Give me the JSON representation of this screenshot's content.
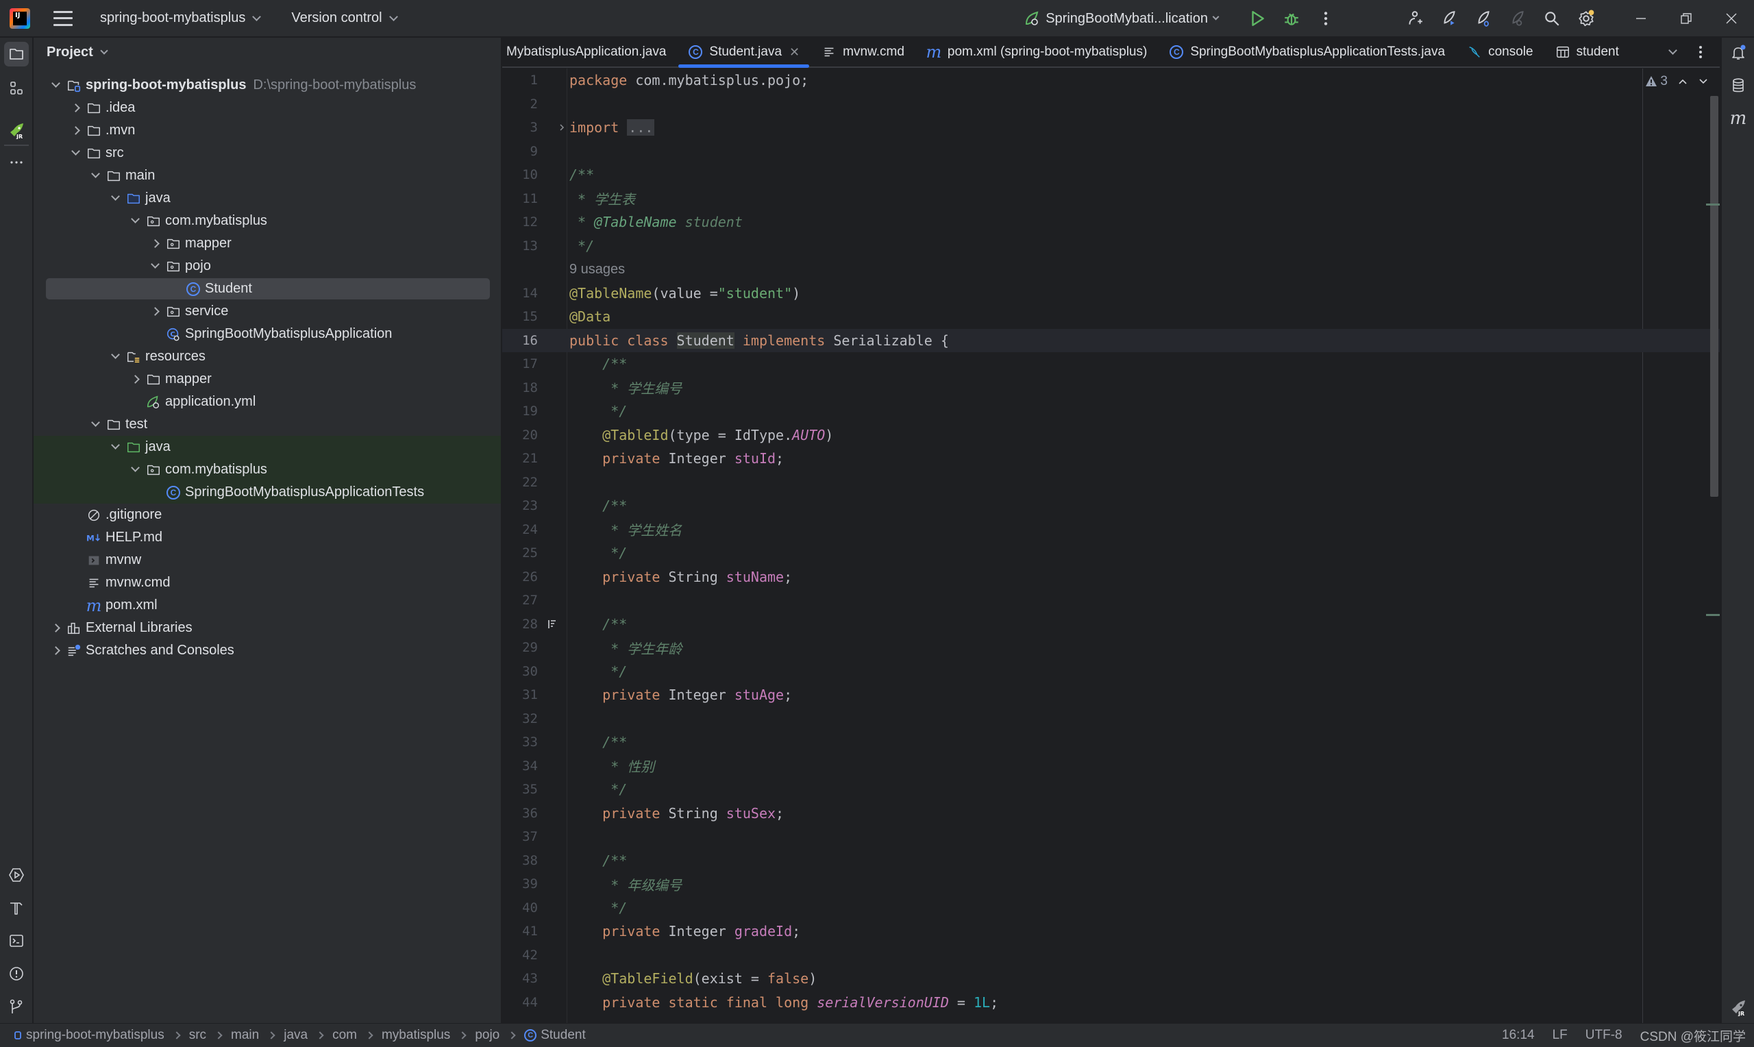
{
  "titlebar": {
    "project_name": "spring-boot-mybatisplus",
    "vcs_label": "Version control",
    "run_config": "SpringBootMybati...lication"
  },
  "project_panel": {
    "title": "Project",
    "tree": [
      {
        "label": "spring-boot-mybatisplus",
        "path": "D:\\spring-boot-mybatisplus",
        "depth": 0,
        "toggle": "expanded",
        "icon": "module-folder-icon",
        "bold": true
      },
      {
        "label": ".idea",
        "depth": 1,
        "toggle": "collapsed",
        "icon": "folder-icon"
      },
      {
        "label": ".mvn",
        "depth": 1,
        "toggle": "collapsed",
        "icon": "folder-icon"
      },
      {
        "label": "src",
        "depth": 1,
        "toggle": "expanded",
        "icon": "folder-icon"
      },
      {
        "label": "main",
        "depth": 2,
        "toggle": "expanded",
        "icon": "folder-icon"
      },
      {
        "label": "java",
        "depth": 3,
        "toggle": "expanded",
        "icon": "source-folder-icon"
      },
      {
        "label": "com.mybatisplus",
        "depth": 4,
        "toggle": "expanded",
        "icon": "package-icon"
      },
      {
        "label": "mapper",
        "depth": 5,
        "toggle": "collapsed",
        "icon": "package-icon"
      },
      {
        "label": "pojo",
        "depth": 5,
        "toggle": "expanded",
        "icon": "package-icon"
      },
      {
        "label": "Student",
        "depth": 6,
        "toggle": "none",
        "icon": "class-icon",
        "selected": true
      },
      {
        "label": "service",
        "depth": 5,
        "toggle": "collapsed",
        "icon": "package-icon"
      },
      {
        "label": "SpringBootMybatisplusApplication",
        "depth": 5,
        "toggle": "none",
        "icon": "spring-class-icon"
      },
      {
        "label": "resources",
        "depth": 3,
        "toggle": "expanded",
        "icon": "resources-folder-icon"
      },
      {
        "label": "mapper",
        "depth": 4,
        "toggle": "collapsed",
        "icon": "folder-icon"
      },
      {
        "label": "application.yml",
        "depth": 4,
        "toggle": "none",
        "icon": "spring-config-icon"
      },
      {
        "label": "test",
        "depth": 2,
        "toggle": "expanded",
        "icon": "folder-icon"
      },
      {
        "label": "java",
        "depth": 3,
        "toggle": "expanded",
        "icon": "test-folder-icon",
        "test": true
      },
      {
        "label": "com.mybatisplus",
        "depth": 4,
        "toggle": "expanded",
        "icon": "package-icon",
        "test": true
      },
      {
        "label": "SpringBootMybatisplusApplicationTests",
        "depth": 5,
        "toggle": "none",
        "icon": "class-icon",
        "test": true
      },
      {
        "label": ".gitignore",
        "depth": 1,
        "toggle": "none",
        "icon": "ignore-file-icon"
      },
      {
        "label": "HELP.md",
        "depth": 1,
        "toggle": "none",
        "icon": "markdown-icon"
      },
      {
        "label": "mvnw",
        "depth": 1,
        "toggle": "none",
        "icon": "shell-script-icon"
      },
      {
        "label": "mvnw.cmd",
        "depth": 1,
        "toggle": "none",
        "icon": "text-file-icon"
      },
      {
        "label": "pom.xml",
        "depth": 1,
        "toggle": "none",
        "icon": "maven-icon"
      },
      {
        "label": "External Libraries",
        "depth": 0,
        "toggle": "collapsed",
        "icon": "libraries-icon"
      },
      {
        "label": "Scratches and Consoles",
        "depth": 0,
        "toggle": "collapsed",
        "icon": "scratches-icon"
      }
    ]
  },
  "tabs": [
    {
      "label": "MybatisplusApplication.java",
      "icon": "none",
      "active": false
    },
    {
      "label": "Student.java",
      "icon": "class-icon",
      "active": true,
      "closable": true
    },
    {
      "label": "mvnw.cmd",
      "icon": "text-file-icon",
      "active": false
    },
    {
      "label": "pom.xml (spring-boot-mybatisplus)",
      "icon": "maven-icon",
      "active": false
    },
    {
      "label": "SpringBootMybatisplusApplicationTests.java",
      "icon": "class-icon",
      "active": false
    },
    {
      "label": "console",
      "icon": "mysql-console-icon",
      "active": false
    },
    {
      "label": "student",
      "icon": "table-icon",
      "active": false
    }
  ],
  "editor": {
    "warnings_count": "3",
    "usages_hint": "9 usages",
    "current_line": 16,
    "lines": [
      {
        "n": "1",
        "tokens": [
          [
            "kw",
            "package"
          ],
          [
            "p",
            " com.mybatisplus.pojo;"
          ]
        ]
      },
      {
        "n": "2",
        "tokens": []
      },
      {
        "n": "3",
        "fold": true,
        "tokens": [
          [
            "kw",
            "import"
          ],
          [
            "p",
            " "
          ],
          [
            "fold",
            "..."
          ]
        ]
      },
      {
        "n": "9",
        "tokens": []
      },
      {
        "n": "10",
        "tokens": [
          [
            "cmt",
            "/**"
          ]
        ]
      },
      {
        "n": "11",
        "tokens": [
          [
            "cmt",
            " * 学生表"
          ]
        ]
      },
      {
        "n": "12",
        "tokens": [
          [
            "cmt",
            " * "
          ],
          [
            "tag",
            "@TableName"
          ],
          [
            "cmt",
            " student"
          ]
        ]
      },
      {
        "n": "13",
        "tokens": [
          [
            "cmt",
            " */"
          ]
        ]
      },
      {
        "n": "",
        "usages": true,
        "tokens": []
      },
      {
        "n": "14",
        "tokens": [
          [
            "ann",
            "@TableName"
          ],
          [
            "p",
            "(value ="
          ],
          [
            "str",
            "\"student\""
          ],
          [
            "p",
            ")"
          ]
        ]
      },
      {
        "n": "15",
        "tokens": [
          [
            "ann",
            "@Data"
          ]
        ]
      },
      {
        "n": "16",
        "current": true,
        "tokens": [
          [
            "kw",
            "public class "
          ],
          [
            "hl",
            "Student"
          ],
          [
            "kw",
            " implements "
          ],
          [
            "p",
            "Serializable {"
          ]
        ]
      },
      {
        "n": "17",
        "tokens": [
          [
            "cmt",
            "    /**"
          ]
        ]
      },
      {
        "n": "18",
        "tokens": [
          [
            "cmt",
            "     * 学生编号"
          ]
        ]
      },
      {
        "n": "19",
        "tokens": [
          [
            "cmt",
            "     */"
          ]
        ]
      },
      {
        "n": "20",
        "tokens": [
          [
            "p",
            "    "
          ],
          [
            "ann",
            "@TableId"
          ],
          [
            "p",
            "(type = IdType."
          ],
          [
            "sfld",
            "AUTO"
          ],
          [
            "p",
            ")"
          ]
        ]
      },
      {
        "n": "21",
        "tokens": [
          [
            "kw",
            "    private "
          ],
          [
            "p",
            "Integer "
          ],
          [
            "fld",
            "stuId"
          ],
          [
            "p",
            ";"
          ]
        ]
      },
      {
        "n": "22",
        "tokens": []
      },
      {
        "n": "23",
        "tokens": [
          [
            "cmt",
            "    /**"
          ]
        ]
      },
      {
        "n": "24",
        "tokens": [
          [
            "cmt",
            "     * 学生姓名"
          ]
        ]
      },
      {
        "n": "25",
        "tokens": [
          [
            "cmt",
            "     */"
          ]
        ]
      },
      {
        "n": "26",
        "tokens": [
          [
            "kw",
            "    private "
          ],
          [
            "p",
            "String "
          ],
          [
            "fld",
            "stuName"
          ],
          [
            "p",
            ";"
          ]
        ]
      },
      {
        "n": "27",
        "tokens": []
      },
      {
        "n": "28",
        "mark": true,
        "tokens": [
          [
            "cmt",
            "    /**"
          ]
        ]
      },
      {
        "n": "29",
        "tokens": [
          [
            "cmt",
            "     * 学生年龄"
          ]
        ]
      },
      {
        "n": "30",
        "tokens": [
          [
            "cmt",
            "     */"
          ]
        ]
      },
      {
        "n": "31",
        "tokens": [
          [
            "kw",
            "    private "
          ],
          [
            "p",
            "Integer "
          ],
          [
            "fld",
            "stuAge"
          ],
          [
            "p",
            ";"
          ]
        ]
      },
      {
        "n": "32",
        "tokens": []
      },
      {
        "n": "33",
        "tokens": [
          [
            "cmt",
            "    /**"
          ]
        ]
      },
      {
        "n": "34",
        "tokens": [
          [
            "cmt",
            "     * 性别"
          ]
        ]
      },
      {
        "n": "35",
        "tokens": [
          [
            "cmt",
            "     */"
          ]
        ]
      },
      {
        "n": "36",
        "tokens": [
          [
            "kw",
            "    private "
          ],
          [
            "p",
            "String "
          ],
          [
            "fld",
            "stuSex"
          ],
          [
            "p",
            ";"
          ]
        ]
      },
      {
        "n": "37",
        "tokens": []
      },
      {
        "n": "38",
        "tokens": [
          [
            "cmt",
            "    /**"
          ]
        ]
      },
      {
        "n": "39",
        "tokens": [
          [
            "cmt",
            "     * 年级编号"
          ]
        ]
      },
      {
        "n": "40",
        "tokens": [
          [
            "cmt",
            "     */"
          ]
        ]
      },
      {
        "n": "41",
        "tokens": [
          [
            "kw",
            "    private "
          ],
          [
            "p",
            "Integer "
          ],
          [
            "fld",
            "gradeId"
          ],
          [
            "p",
            ";"
          ]
        ]
      },
      {
        "n": "42",
        "tokens": []
      },
      {
        "n": "43",
        "tokens": [
          [
            "p",
            "    "
          ],
          [
            "ann",
            "@TableField"
          ],
          [
            "p",
            "(exist = "
          ],
          [
            "kw",
            "false"
          ],
          [
            "p",
            ")"
          ]
        ]
      },
      {
        "n": "44",
        "tokens": [
          [
            "kw",
            "    private static final long "
          ],
          [
            "sfld",
            "serialVersionUID"
          ],
          [
            "p",
            " = "
          ],
          [
            "num",
            "1L"
          ],
          [
            "p",
            ";"
          ]
        ]
      }
    ]
  },
  "statusbar": {
    "breadcrumbs": [
      "spring-boot-mybatisplus",
      "src",
      "main",
      "java",
      "com",
      "mybatisplus",
      "pojo",
      "Student"
    ],
    "position": "16:14",
    "line_ending": "LF",
    "encoding": "UTF-8",
    "watermark": "CSDN @筱江同学"
  },
  "colors": {
    "accent": "#3574f0",
    "background": "#1e1f22",
    "panel": "#2b2d30",
    "run_green": "#5fb865"
  }
}
